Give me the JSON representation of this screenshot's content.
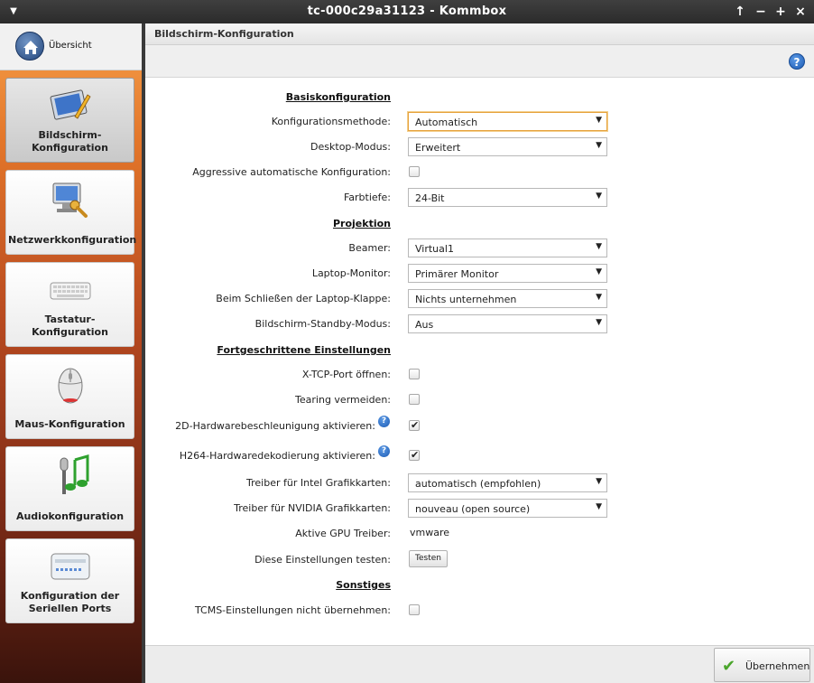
{
  "window": {
    "title": "tc-000c29a31123 - Kommbox",
    "minimize": "−",
    "maximize": "+",
    "close": "×",
    "pin": "↑"
  },
  "sidebar": {
    "overview_label": "Übersicht",
    "items": [
      {
        "label": "Bildschirm-\nKonfiguration",
        "active": true
      },
      {
        "label": "Netzwerkkonfiguration"
      },
      {
        "label": "Tastatur-\nKonfiguration"
      },
      {
        "label": "Maus-Konfiguration"
      },
      {
        "label": "Audiokonfiguration"
      },
      {
        "label": "Konfiguration der\nSeriellen Ports"
      }
    ]
  },
  "main": {
    "header_title": "Bildschirm-Konfiguration",
    "help": "?",
    "sections": {
      "basis": "Basiskonfiguration",
      "projektion": "Projektion",
      "fortgeschritten": "Fortgeschrittene Einstellungen",
      "sonstiges": "Sonstiges"
    },
    "fields": {
      "konfigurationsmethode": {
        "label": "Konfigurationsmethode:",
        "value": "Automatisch"
      },
      "desktop_modus": {
        "label": "Desktop-Modus:",
        "value": "Erweitert"
      },
      "aggressive": {
        "label": "Aggressive automatische Konfiguration:",
        "checked": false
      },
      "farbtiefe": {
        "label": "Farbtiefe:",
        "value": "24-Bit"
      },
      "beamer": {
        "label": "Beamer:",
        "value": "Virtual1"
      },
      "laptop_monitor": {
        "label": "Laptop-Monitor:",
        "value": "Primärer Monitor"
      },
      "laptop_klappe": {
        "label": "Beim Schließen der Laptop-Klappe:",
        "value": "Nichts unternehmen"
      },
      "standby": {
        "label": "Bildschirm-Standby-Modus:",
        "value": "Aus"
      },
      "xtcp": {
        "label": "X-TCP-Port öffnen:",
        "checked": false
      },
      "tearing": {
        "label": "Tearing vermeiden:",
        "checked": false
      },
      "hw2d": {
        "label": "2D-Hardwarebeschleunigung aktivieren:",
        "checked": true
      },
      "h264": {
        "label": "H264-Hardwaredekodierung aktivieren:",
        "checked": true
      },
      "intel": {
        "label": "Treiber für Intel Grafikkarten:",
        "value": "automatisch (empfohlen)"
      },
      "nvidia": {
        "label": "Treiber für NVIDIA Grafikkarten:",
        "value": "nouveau (open source)"
      },
      "gpu": {
        "label": "Aktive GPU Treiber:",
        "value": "vmware"
      },
      "test": {
        "label": "Diese Einstellungen testen:",
        "button": "Testen"
      },
      "tcms": {
        "label": "TCMS-Einstellungen nicht übernehmen:",
        "checked": false
      }
    },
    "apply_label": "Übernehmen"
  },
  "colors": {
    "accent": "#e6a23c",
    "help_blue": "#1c5bb4",
    "apply_check": "#4aa52b",
    "sidebar_top": "#f6a04a",
    "sidebar_bottom": "#3a130c"
  }
}
